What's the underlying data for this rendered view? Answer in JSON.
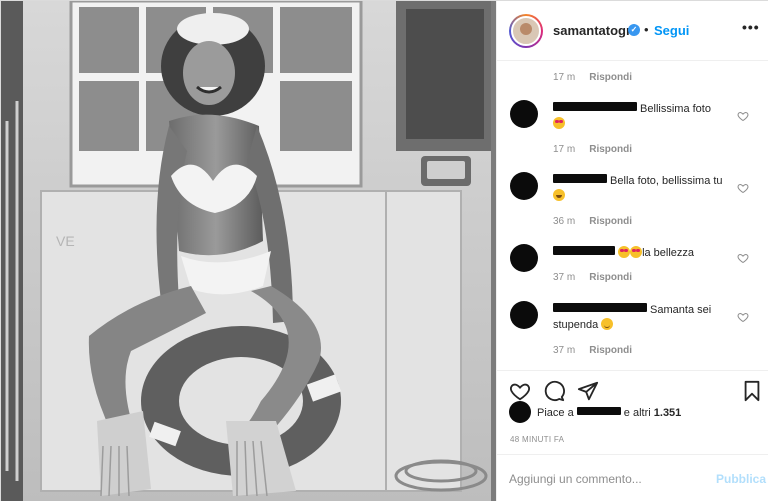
{
  "header": {
    "username": "samantatogni",
    "separator": "•",
    "follow_label": "Segui",
    "more_label": "•••"
  },
  "comments": [
    {
      "text": "",
      "meta_time": "17 m",
      "reply_label": "Rispondi"
    },
    {
      "text": " Bellissima foto",
      "emoji": "heart-eyes-emoji",
      "meta_time": "17 m",
      "reply_label": "Rispondi"
    },
    {
      "text": " Bella foto, bellissima tu",
      "emoji": "grin-emoji",
      "meta_time": "36 m",
      "reply_label": "Rispondi"
    },
    {
      "text": "la bellezza",
      "emoji": "heart-eyes-emoji",
      "meta_time": "37 m",
      "reply_label": "Rispondi"
    },
    {
      "text": " Samanta sei stupenda",
      "emoji": "blush-emoji",
      "meta_time": "37 m",
      "reply_label": "Rispondi"
    }
  ],
  "likes": {
    "prefix": "Piace a ",
    "suffix": " e altri ",
    "count": "1.351"
  },
  "time_ago": "48 MINUTI FA",
  "add_comment": {
    "placeholder": "Aggiungi un commento...",
    "publish_label": "Pubblica"
  },
  "colors": {
    "accent": "#0095f6",
    "publish_disabled": "#b2dffc",
    "verified": "#3897f0"
  },
  "icons": [
    "heart-icon",
    "comment-icon",
    "share-icon",
    "bookmark-icon",
    "verified-icon",
    "more-icon"
  ]
}
